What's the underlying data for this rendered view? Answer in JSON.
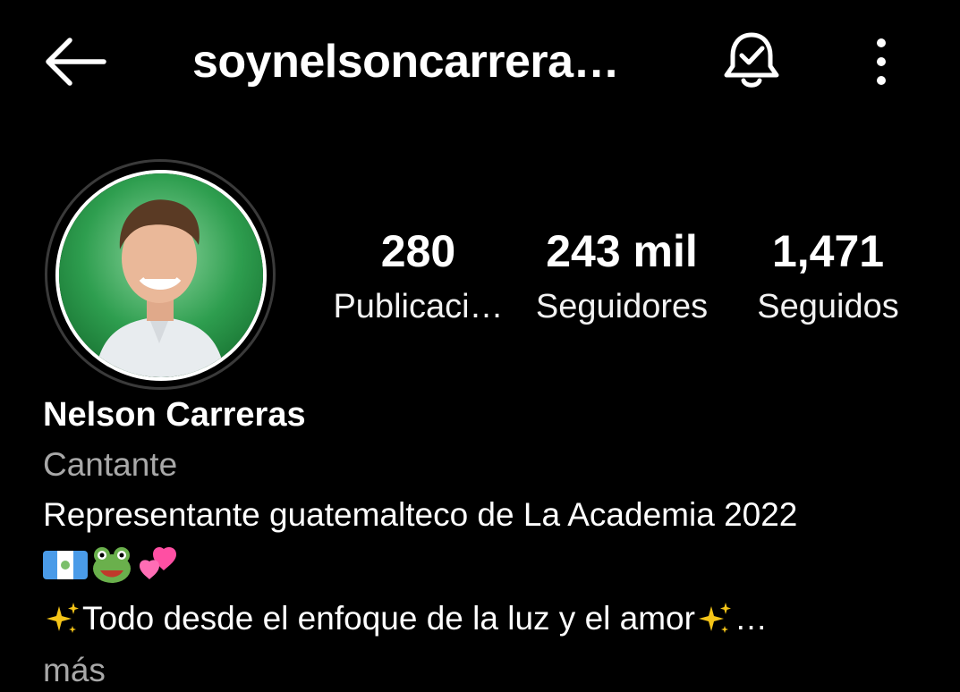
{
  "header": {
    "username": "soynelsoncarrera…"
  },
  "stats": {
    "posts_count": "280",
    "posts_label": "Publicaci…",
    "followers_count": "243 mil",
    "followers_label": "Seguidores",
    "following_count": "1,471",
    "following_label": "Seguidos"
  },
  "profile": {
    "name": "Nelson Carreras",
    "category": "Cantante",
    "bio_line1": "Representante guatemalteco de La Academia 2022",
    "bio_emojis": [
      "guatemala-flag",
      "frog-face",
      "two-hearts"
    ],
    "bio_line3": "Todo desde el enfoque de la luz y el amor",
    "bio_line3_suffix": "…",
    "more_label": "más"
  },
  "colors": {
    "background": "#000000",
    "text": "#ffffff",
    "secondary_text": "#a8a8a8",
    "avatar_bg": "#2e9e4f"
  }
}
